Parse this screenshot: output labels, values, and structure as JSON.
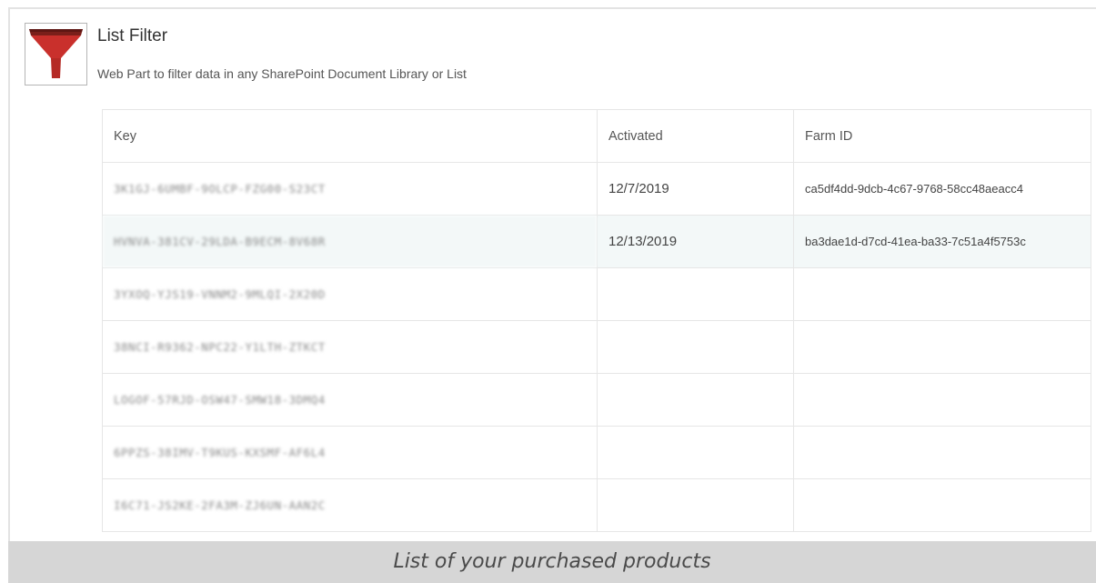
{
  "product": {
    "title": "List Filter",
    "description": "Web Part to filter data in any SharePoint Document Library or List",
    "icon": "funnel-icon",
    "icon_color": "#c0392b"
  },
  "table": {
    "columns": [
      "Key",
      "Activated",
      "Farm ID"
    ],
    "rows": [
      {
        "key": "3K1GJ-6UMBF-9OLCP-FZG00-S23CT",
        "activated": "12/7/2019",
        "farm_id": "ca5df4dd-9dcb-4c67-9768-58cc48aeacc4"
      },
      {
        "key": "HVNVA-381CV-29LDA-B9ECM-8V68R",
        "activated": "12/13/2019",
        "farm_id": "ba3dae1d-d7cd-41ea-ba33-7c51a4f5753c"
      },
      {
        "key": "3YXOQ-YJS19-VNNM2-9MLQI-2X20D",
        "activated": "",
        "farm_id": ""
      },
      {
        "key": "38NCI-R9362-NPC22-Y1LTH-ZTKCT",
        "activated": "",
        "farm_id": ""
      },
      {
        "key": "LOGOF-57RJD-OSW47-SMW18-3DMQ4",
        "activated": "",
        "farm_id": ""
      },
      {
        "key": "6PPZS-38IMV-T9KUS-KXSMF-AF6L4",
        "activated": "",
        "farm_id": ""
      },
      {
        "key": "I6C71-JS2KE-2FA3M-ZJ6UN-AAN2C",
        "activated": "",
        "farm_id": ""
      }
    ],
    "highlight_color": "#f3f8f8"
  },
  "caption": "List of your purchased products"
}
